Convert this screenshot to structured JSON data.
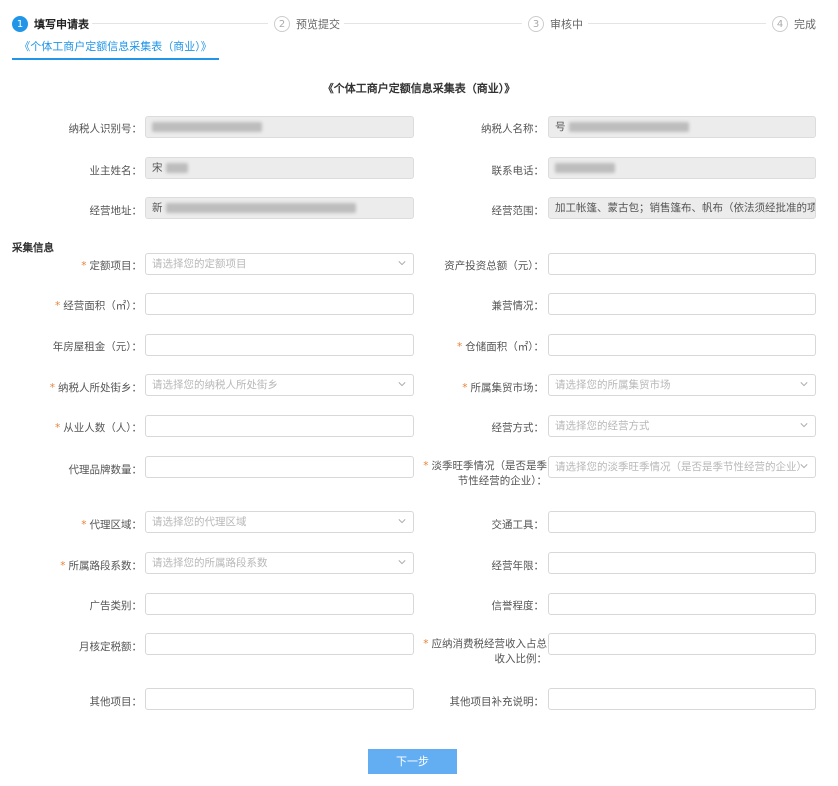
{
  "steps": [
    {
      "num": "1",
      "label": "填写申请表"
    },
    {
      "num": "2",
      "label": "预览提交"
    },
    {
      "num": "3",
      "label": "审核中"
    },
    {
      "num": "4",
      "label": "完成"
    }
  ],
  "tab": {
    "label": "《个体工商户定额信息采集表（商业）》"
  },
  "form_title": "《个体工商户定额信息采集表（商业）》",
  "basic": {
    "taxpayer_id_label": "纳税人识别号：",
    "taxpayer_name_label": "纳税人名称：",
    "taxpayer_name_prefix": "号",
    "owner_label": "业主姓名：",
    "owner_prefix": "宋",
    "phone_label": "联系电话：",
    "address_label": "经营地址：",
    "address_prefix": "新",
    "scope_label": "经营范围：",
    "scope_value": "加工帐篷、蒙古包；销售篷布、帆布（依法须经批准的项目，经相关部门批准后方可开展经营活动）"
  },
  "section_title": "采集信息",
  "fields": {
    "quota_item_label": "定额项目：",
    "quota_item_placeholder": "请选择您的定额项目",
    "investment_label": "资产投资总额（元）：",
    "area_label": "经营面积（㎡）：",
    "side_business_label": "兼营情况：",
    "rent_label": "年房屋租金（元）：",
    "storage_area_label": "仓储面积（㎡）：",
    "street_label": "纳税人所处街乡：",
    "street_placeholder": "请选择您的纳税人所处街乡",
    "market_label": "所属集贸市场：",
    "market_placeholder": "请选择您的所属集贸市场",
    "staff_label": "从业人数（人）：",
    "mode_label": "经营方式：",
    "mode_placeholder": "请选择您的经营方式",
    "brand_label": "代理品牌数量：",
    "season_label": "淡季旺季情况（是否是季节性经营的企业）：",
    "season_placeholder": "请选择您的淡季旺季情况（是否是季节性经营的企业）",
    "region_label": "代理区域：",
    "region_placeholder": "请选择您的代理区域",
    "traffic_label": "交通工具：",
    "road_label": "所属路段系数：",
    "road_placeholder": "请选择您的所属路段系数",
    "years_label": "经营年限：",
    "ad_label": "广告类别：",
    "credit_label": "信誉程度：",
    "monthly_tax_label": "月核定税额：",
    "ratio_label": "应纳消费税经营收入占总收入比例：",
    "other_label": "其他项目：",
    "other_note_label": "其他项目补充说明："
  },
  "buttons": {
    "next": "下一步"
  }
}
